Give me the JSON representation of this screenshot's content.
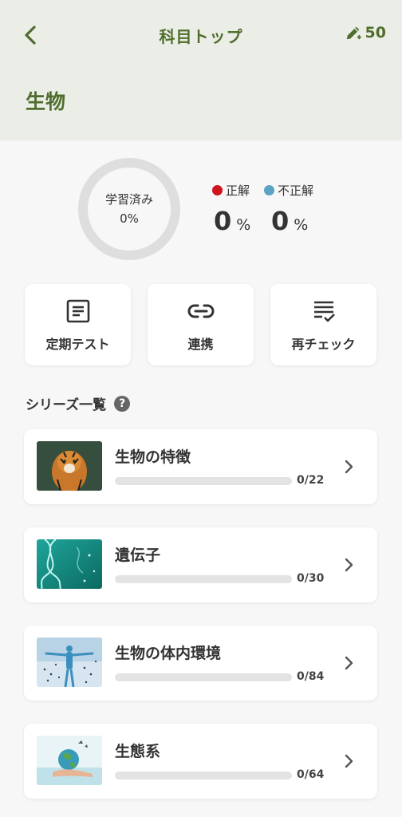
{
  "header": {
    "title": "科目トップ",
    "points": "50",
    "subject": "生物",
    "back_icon": "chevron-left-icon",
    "points_icon": "pencil-icon"
  },
  "progress": {
    "studied_label": "学習済み",
    "studied_value": "0%",
    "studied_fraction": 0,
    "correct_label": "正解",
    "correct_value": "0",
    "correct_color": "#d0141d",
    "incorrect_label": "不正解",
    "incorrect_value": "0",
    "incorrect_color": "#5aa3c4",
    "unit": "%"
  },
  "actions": [
    {
      "label": "定期テスト",
      "icon": "document-icon"
    },
    {
      "label": "連携",
      "icon": "link-icon"
    },
    {
      "label": "再チェック",
      "icon": "checklist-icon"
    }
  ],
  "series_heading": "シリーズ一覧",
  "series": [
    {
      "name": "生物の特徴",
      "count": "0/22",
      "progress": 0,
      "thumb": "tiger-image"
    },
    {
      "name": "遺伝子",
      "count": "0/30",
      "progress": 0,
      "thumb": "dna-image"
    },
    {
      "name": "生物の体内環境",
      "count": "0/84",
      "progress": 0,
      "thumb": "human-body-image"
    },
    {
      "name": "生態系",
      "count": "0/64",
      "progress": 0,
      "thumb": "earth-in-hand-image"
    }
  ],
  "colors": {
    "accent": "#4f6d2c",
    "header_bg": "#ebeee7",
    "page_bg": "#f7f7f7"
  }
}
